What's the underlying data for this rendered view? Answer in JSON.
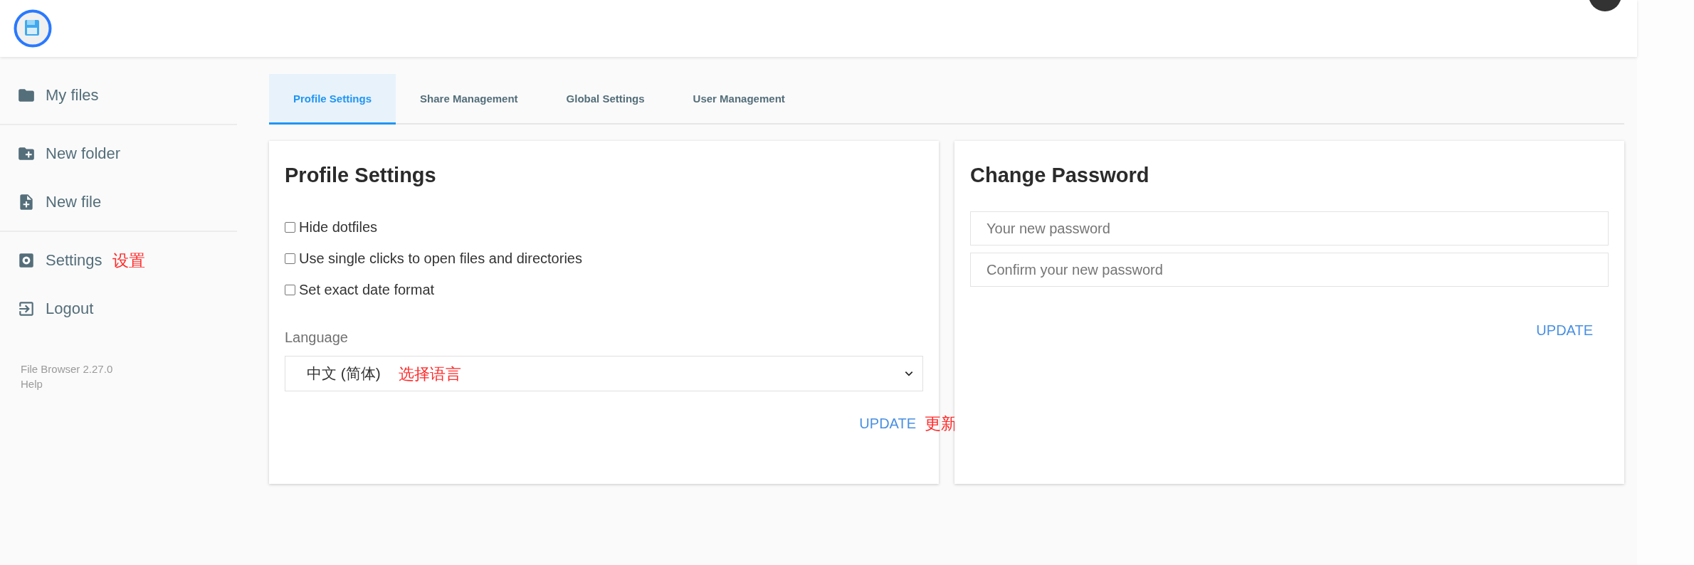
{
  "sidebar": {
    "groups": [
      [
        {
          "label": "My files",
          "kind": "folder"
        }
      ],
      [
        {
          "label": "New folder",
          "kind": "new-folder"
        },
        {
          "label": "New file",
          "kind": "new-file"
        }
      ],
      [
        {
          "label": "Settings",
          "kind": "settings",
          "annotation": "设置"
        },
        {
          "label": "Logout",
          "kind": "logout"
        }
      ]
    ],
    "footer": [
      "File Browser 2.27.0",
      "Help"
    ]
  },
  "tabs": [
    {
      "label": "Profile Settings",
      "selected": true
    },
    {
      "label": "Share Management",
      "selected": false
    },
    {
      "label": "Global Settings",
      "selected": false
    },
    {
      "label": "User Management",
      "selected": false
    }
  ],
  "profile_card": {
    "title": "Profile Settings",
    "options": [
      {
        "label": "Hide dotfiles",
        "checked": false
      },
      {
        "label": "Use single clicks to open files and directories",
        "checked": false
      },
      {
        "label": "Set exact date format",
        "checked": false
      }
    ],
    "language": {
      "label": "Language",
      "value": "中文 (简体)",
      "annotation": "选择语言"
    },
    "button": "UPDATE",
    "button_annotation": "更新"
  },
  "password_card": {
    "title": "Change Password",
    "fields": [
      {
        "placeholder": "Your new password"
      },
      {
        "placeholder": "Confirm your new password"
      }
    ],
    "button": "UPDATE"
  }
}
